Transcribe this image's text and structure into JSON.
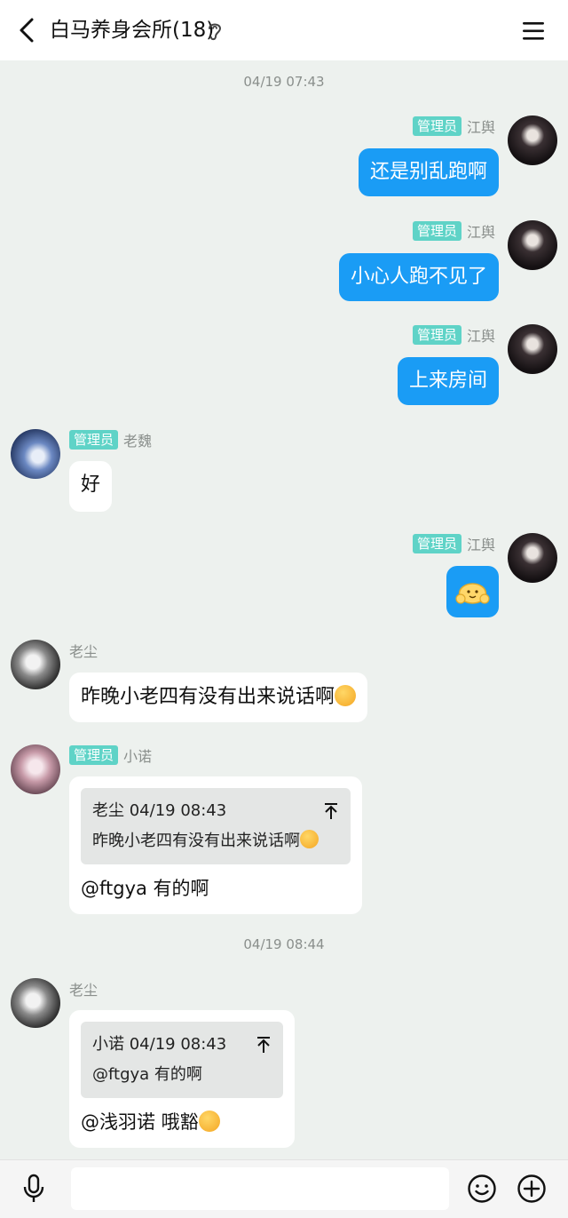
{
  "header": {
    "title": "白马养身会所(18)"
  },
  "timestamps": [
    "04/19 07:43",
    "04/19 08:44"
  ],
  "admin_badge": "管理员",
  "messages": [
    {
      "sender": "江舆",
      "text": "还是别乱跑啊"
    },
    {
      "sender": "江舆",
      "text": "小心人跑不见了"
    },
    {
      "sender": "江舆",
      "text": "上来房间"
    },
    {
      "sender": "老魏",
      "text": "好"
    },
    {
      "sender": "江舆",
      "sticker": "yellow-blob-sticker"
    },
    {
      "sender": "老尘",
      "text": "昨晚小老四有没有出来说话啊"
    },
    {
      "sender": "小诺",
      "quote": {
        "author": "老尘",
        "time": "04/19 08:43",
        "text": "昨晚小老四有没有出来说话啊"
      },
      "text": "@ftgya 有的啊"
    },
    {
      "sender": "老尘",
      "quote": {
        "author": "小诺",
        "time": "04/19 08:43",
        "text": "@ftgya 有的啊"
      },
      "text": "@浅羽诺 哦豁"
    }
  ],
  "composer": {
    "value": ""
  },
  "colors": {
    "outgoing_bubble": "#1a9cf5",
    "badge": "#5fd3c7",
    "background": "#edf1ee"
  }
}
